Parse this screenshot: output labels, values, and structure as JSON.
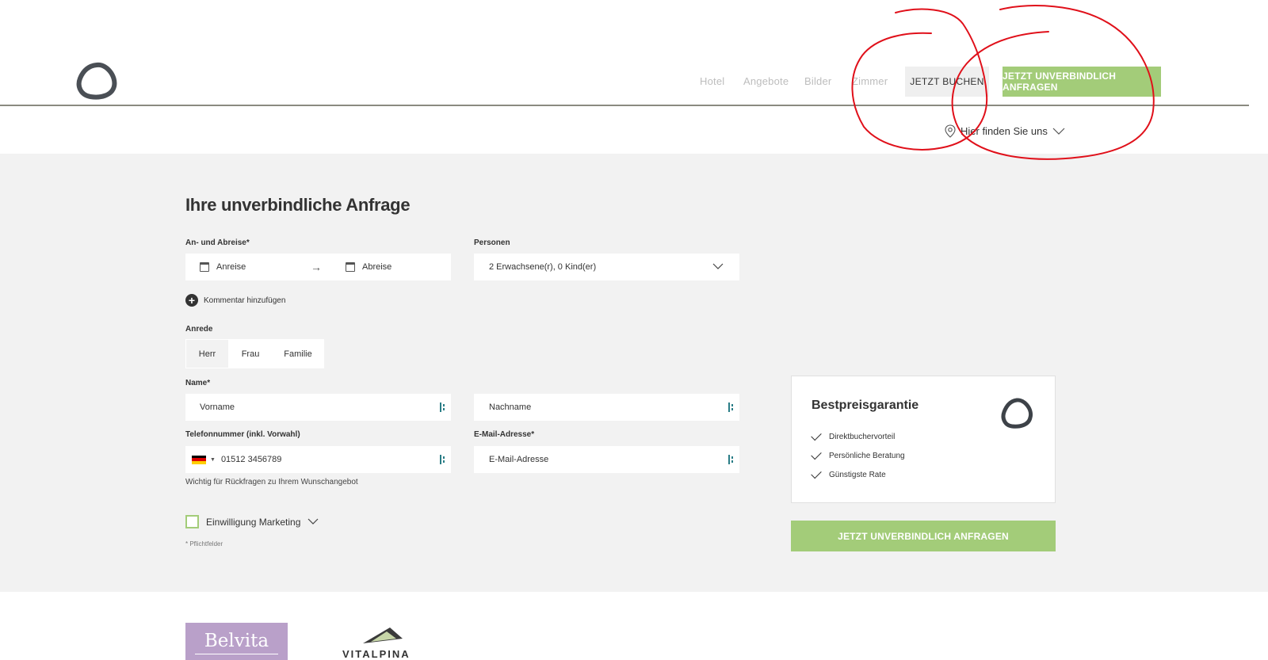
{
  "header": {
    "nav": [
      "Hotel",
      "Angebote",
      "Bilder",
      "Zimmer"
    ],
    "book_button": "JETZT BUCHEN",
    "inquiry_button": "JETZT UNVERBINDLICH ANFRAGEN",
    "find_us": "Hier finden Sie uns"
  },
  "form": {
    "title": "Ihre unverbindliche Anfrage",
    "dates_label": "An- und Abreise*",
    "arrival_placeholder": "Anreise",
    "departure_placeholder": "Abreise",
    "persons_label": "Personen",
    "persons_value": "2 Erwachsene(r), 0 Kind(er)",
    "comment_link": "Kommentar hinzufügen",
    "salutation_label": "Anrede",
    "salutation_options": [
      "Herr",
      "Frau",
      "Familie"
    ],
    "salutation_selected": "Herr",
    "name_label": "Name*",
    "firstname_placeholder": "Vorname",
    "lastname_placeholder": "Nachname",
    "phone_label": "Telefonnummer (inkl. Vorwahl)",
    "phone_value": "01512 3456789",
    "email_label": "E-Mail-Adresse*",
    "email_placeholder": "E-Mail-Adresse",
    "phone_hint": "Wichtig für Rückfragen zu Ihrem Wunschangebot",
    "consent_label": "Einwilligung Marketing",
    "required_note": "* Pflichtfelder"
  },
  "side_box": {
    "title": "Bestpreisgarantie",
    "items": [
      "Direktbuchervorteil",
      "Persönliche Beratung",
      "Günstigste Rate"
    ],
    "submit_button": "JETZT UNVERBINDLICH ANFRAGEN"
  },
  "footer": {
    "partner_logos": [
      "Belvita",
      "VITALPINA"
    ]
  },
  "colors": {
    "accent_green": "#a3cc79",
    "annotation_red": "#e0101a",
    "background_grey": "#f2f2f2"
  }
}
